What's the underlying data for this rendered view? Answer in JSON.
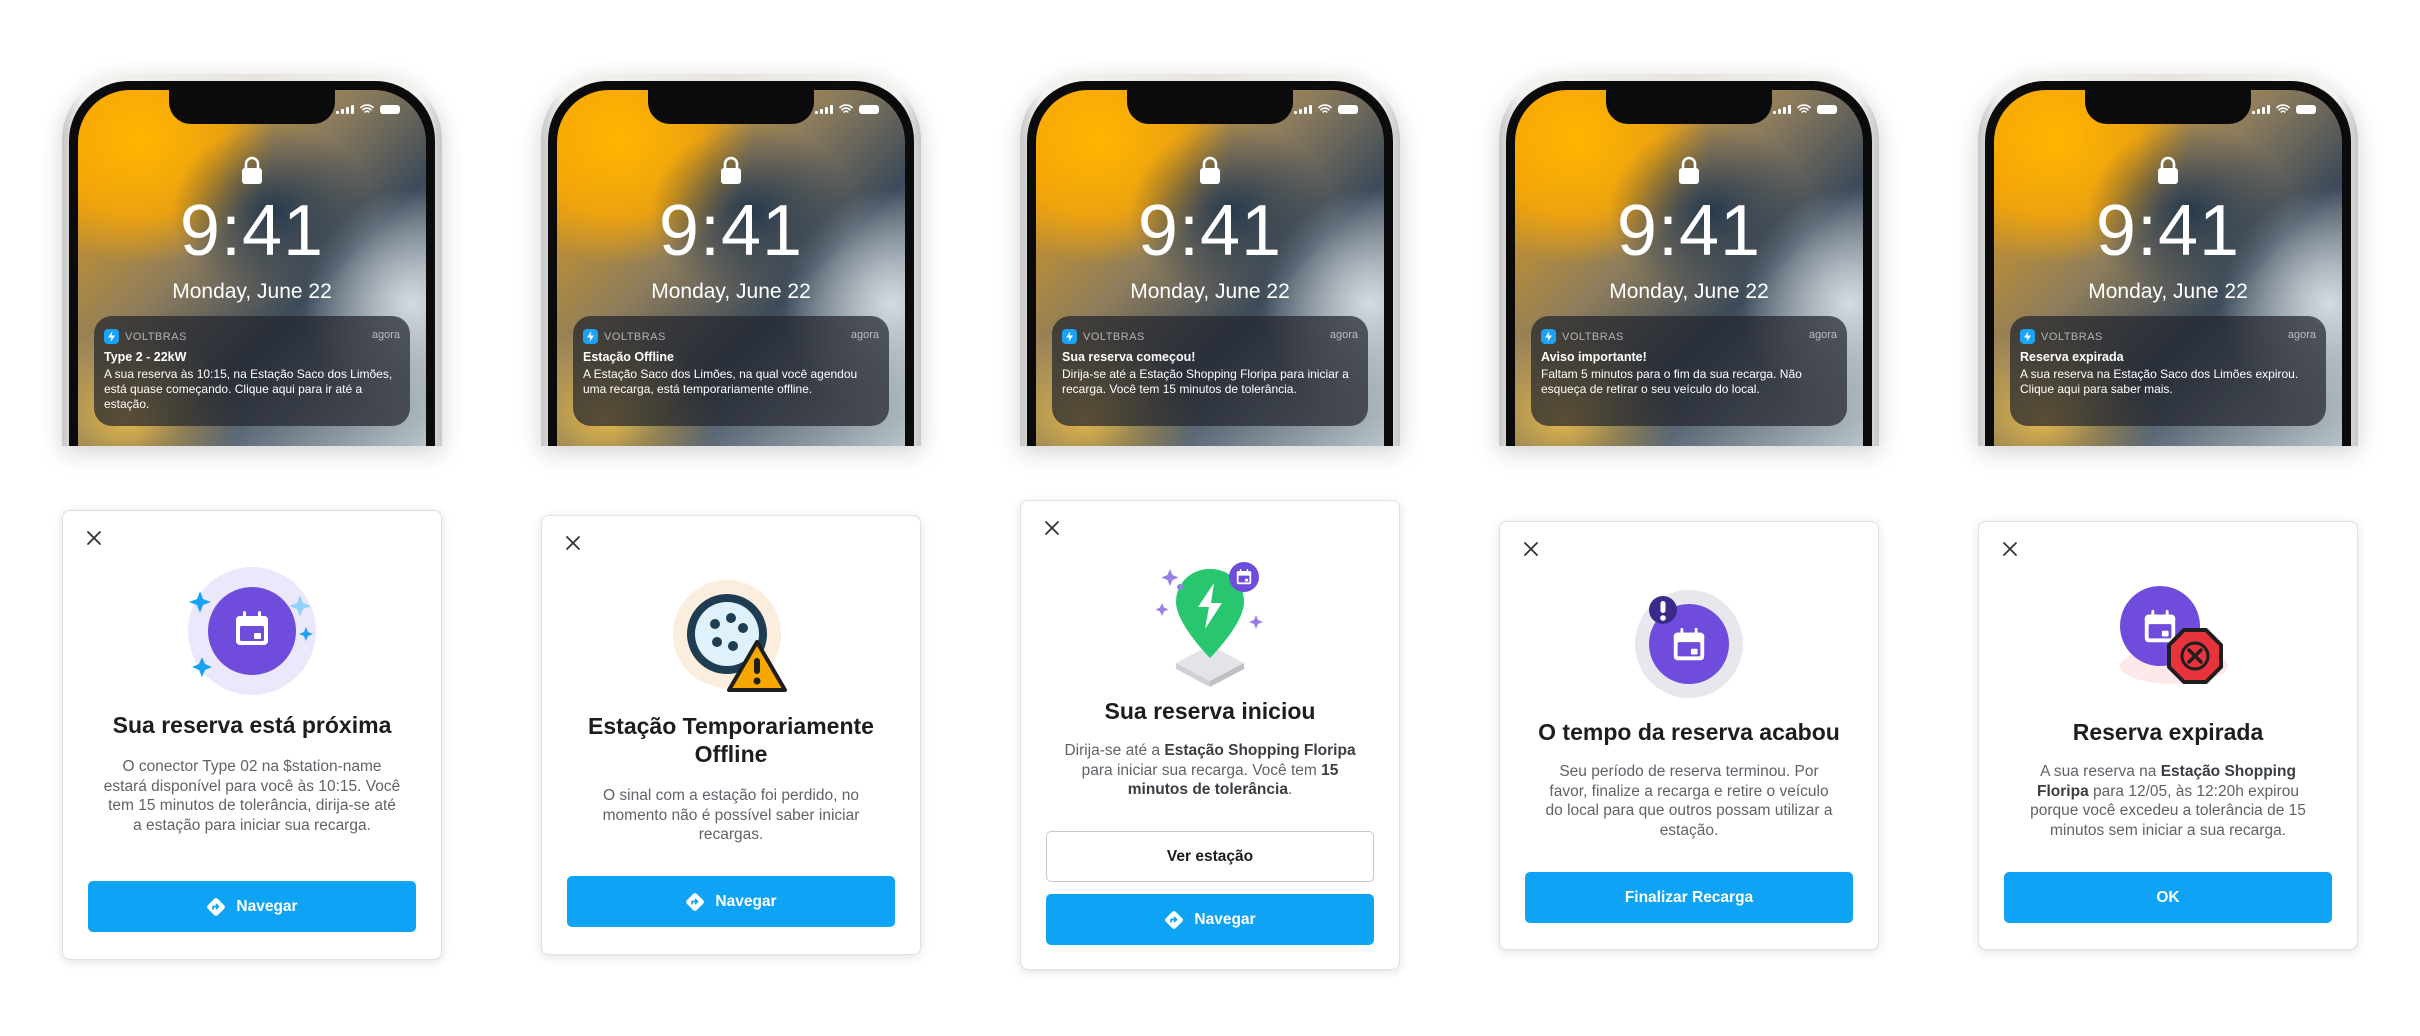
{
  "lockscreen": {
    "time": "9:41",
    "date": "Monday, June 22"
  },
  "columns": [
    {
      "notification": {
        "app": "VOLTBRAS",
        "when": "agora",
        "title": "Type 2 - 22kW",
        "body": "A sua reserva às 10:15, na Estação Saco dos Limões, está quase começando. Clique aqui para ir até a estação."
      },
      "card": {
        "title": "Sua reserva está próxima",
        "body": "O conector Type 02 na $station-name estará disponível para você às 10:15. Você tem 15 minutos de tolerância, dirija-se até a estação para iniciar sua recarga.",
        "button": "Navegar",
        "icon": "calendar-sparkle-icon"
      }
    },
    {
      "notification": {
        "app": "VOLTBRAS",
        "when": "agora",
        "title": "Estação Offline",
        "body": "A Estação Saco dos Limões, na qual você agendou uma recarga, está temporariamente offline."
      },
      "card": {
        "title": "Estação Temporariamente Offline",
        "body": "O sinal com a estação foi perdido, no momento não é possível saber iniciar recargas.",
        "button": "Navegar",
        "icon": "plug-warning-icon"
      }
    },
    {
      "notification": {
        "app": "VOLTBRAS",
        "when": "agora",
        "title": "Sua reserva começou!",
        "body": "Dirija-se até a Estação Shopping Floripa para iniciar a recarga. Você tem 15 minutos de tolerância."
      },
      "card": {
        "title": "Sua reserva iniciou",
        "body_pre": "Dirija-se até a ",
        "body_bold1": "Estação Shopping Floripa",
        "body_mid": " para iniciar sua recarga. Você tem ",
        "body_bold2": "15 minutos de tolerância",
        "body_post": ".",
        "secondary_button": "Ver estação",
        "button": "Navegar",
        "icon": "charging-pin-icon"
      }
    },
    {
      "notification": {
        "app": "VOLTBRAS",
        "when": "agora",
        "title": "Aviso importante!",
        "body": "Faltam 5 minutos para o fim da sua recarga. Não esqueça de retirar o seu veículo do local."
      },
      "card": {
        "title": "O tempo da reserva acabou",
        "body": "Seu período de reserva terminou. Por favor, finalize a recarga e retire o veículo do local para que outros possam utilizar a estação.",
        "button": "Finalizar Recarga",
        "icon": "calendar-alert-icon"
      }
    },
    {
      "notification": {
        "app": "VOLTBRAS",
        "when": "agora",
        "title": "Reserva expirada",
        "body": "A sua reserva na Estação Saco dos Limões expirou. Clique aqui para saber mais."
      },
      "card": {
        "title": "Reserva expirada",
        "body_pre": "A sua reserva na ",
        "body_bold1": "Estação Shopping Floripa",
        "body_post": " para 12/05, às 12:20h expirou porque você excedeu a tolerância de 15 minutos sem iniciar a sua recarga.",
        "button": "OK",
        "icon": "calendar-expired-icon"
      }
    }
  ]
}
